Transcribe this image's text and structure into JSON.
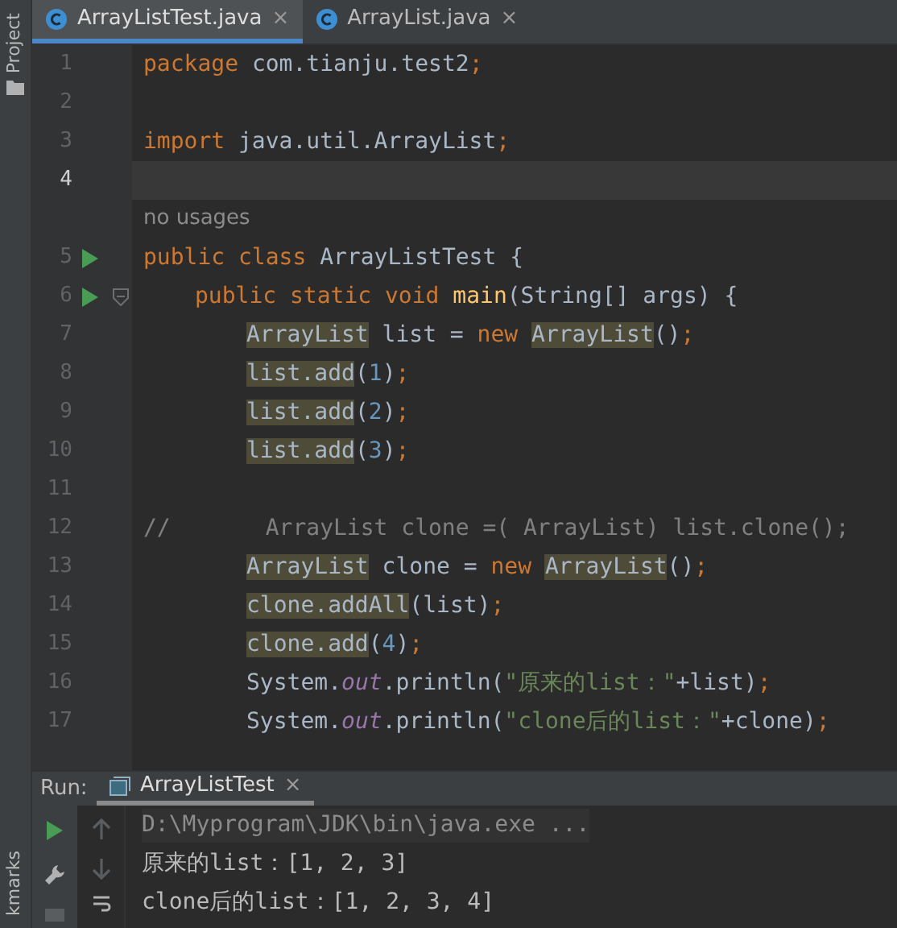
{
  "side_strip": {
    "top_label": "Project",
    "bottom_label": "kmarks"
  },
  "tabs": [
    {
      "label": "ArrayListTest.java",
      "selected": true,
      "close": "×"
    },
    {
      "label": "ArrayList.java",
      "selected": false,
      "close": "×"
    }
  ],
  "editor": {
    "lines": [
      {
        "kind": "top",
        "number": "1",
        "current": false,
        "run": false,
        "fold": false,
        "tokens": [
          {
            "t": "package",
            "kind": "kw"
          },
          {
            "t": " com.tianju.test2",
            "kind": "plain"
          },
          {
            "t": ";",
            "kind": "kw"
          }
        ]
      },
      {
        "kind": "top",
        "number": "2",
        "current": false,
        "run": false,
        "fold": false
      },
      {
        "kind": "top",
        "number": "3",
        "current": false,
        "run": false,
        "fold": false,
        "tokens": [
          {
            "t": "import",
            "kind": "kw"
          },
          {
            "t": " java.util.ArrayList",
            "kind": "plain"
          },
          {
            "t": ";",
            "kind": "kw"
          }
        ]
      },
      {
        "kind": "top",
        "number": "4",
        "current": true,
        "run": false,
        "fold": false
      },
      {
        "kind": "hint",
        "text": "no usages"
      },
      {
        "kind": "top",
        "number": "5",
        "current": false,
        "run": true,
        "fold": false,
        "tokens": [
          {
            "t": "public class",
            "kind": "kw"
          },
          {
            "t": " ArrayListTest {",
            "kind": "plain"
          }
        ]
      },
      {
        "kind": "member",
        "number": "6",
        "current": false,
        "run": true,
        "fold": true,
        "tokens": [
          {
            "t": "public static void ",
            "kind": "kw"
          },
          {
            "t": "main",
            "kind": "method"
          },
          {
            "t": "(String[] args) {",
            "kind": "plain"
          }
        ]
      },
      {
        "kind": "body",
        "number": "7",
        "current": false,
        "run": false,
        "fold": false,
        "tokens": [
          {
            "t": "ArrayList",
            "kind": "hl"
          },
          {
            "t": " list = ",
            "kind": "plain"
          },
          {
            "t": "new ",
            "kind": "kw"
          },
          {
            "t": "ArrayList",
            "kind": "hl"
          },
          {
            "t": "()",
            "kind": "plain"
          },
          {
            "t": ";",
            "kind": "kw"
          }
        ]
      },
      {
        "kind": "body",
        "number": "8",
        "current": false,
        "run": false,
        "fold": false,
        "tokens": [
          {
            "t": "list.add",
            "kind": "hl"
          },
          {
            "t": "(",
            "kind": "plain"
          },
          {
            "t": "1",
            "kind": "num"
          },
          {
            "t": ")",
            "kind": "plain"
          },
          {
            "t": ";",
            "kind": "kw"
          }
        ]
      },
      {
        "kind": "body",
        "number": "9",
        "current": false,
        "run": false,
        "fold": false,
        "tokens": [
          {
            "t": "list.add",
            "kind": "hl"
          },
          {
            "t": "(",
            "kind": "plain"
          },
          {
            "t": "2",
            "kind": "num"
          },
          {
            "t": ")",
            "kind": "plain"
          },
          {
            "t": ";",
            "kind": "kw"
          }
        ]
      },
      {
        "kind": "body",
        "number": "10",
        "current": false,
        "run": false,
        "fold": false,
        "tokens": [
          {
            "t": "list.add",
            "kind": "hl"
          },
          {
            "t": "(",
            "kind": "plain"
          },
          {
            "t": "3",
            "kind": "num"
          },
          {
            "t": ")",
            "kind": "plain"
          },
          {
            "t": ";",
            "kind": "kw"
          }
        ]
      },
      {
        "kind": "top",
        "number": "11",
        "current": false,
        "run": false,
        "fold": false
      },
      {
        "kind": "top",
        "number": "12",
        "current": false,
        "run": false,
        "fold": false,
        "tokens": [
          {
            "t": "//       ArrayList clone =( ArrayList) list.clone();",
            "kind": "comment"
          }
        ]
      },
      {
        "kind": "body",
        "number": "13",
        "current": false,
        "run": false,
        "fold": false,
        "tokens": [
          {
            "t": "ArrayList",
            "kind": "hl"
          },
          {
            "t": " clone = ",
            "kind": "plain"
          },
          {
            "t": "new ",
            "kind": "kw"
          },
          {
            "t": "ArrayList",
            "kind": "hl"
          },
          {
            "t": "()",
            "kind": "plain"
          },
          {
            "t": ";",
            "kind": "kw"
          }
        ]
      },
      {
        "kind": "body",
        "number": "14",
        "current": false,
        "run": false,
        "fold": false,
        "tokens": [
          {
            "t": "clone.addAll",
            "kind": "hl"
          },
          {
            "t": "(list)",
            "kind": "plain"
          },
          {
            "t": ";",
            "kind": "kw"
          }
        ]
      },
      {
        "kind": "body",
        "number": "15",
        "current": false,
        "run": false,
        "fold": false,
        "tokens": [
          {
            "t": "clone.add",
            "kind": "hl"
          },
          {
            "t": "(",
            "kind": "plain"
          },
          {
            "t": "4",
            "kind": "num"
          },
          {
            "t": ")",
            "kind": "plain"
          },
          {
            "t": ";",
            "kind": "kw"
          }
        ]
      },
      {
        "kind": "body",
        "number": "16",
        "current": false,
        "run": false,
        "fold": false,
        "tokens": [
          {
            "t": "System.",
            "kind": "plain"
          },
          {
            "t": "out",
            "kind": "field"
          },
          {
            "t": ".println(",
            "kind": "plain"
          },
          {
            "t": "\"原来的list：\"",
            "kind": "str"
          },
          {
            "t": "+list)",
            "kind": "plain"
          },
          {
            "t": ";",
            "kind": "kw"
          }
        ]
      },
      {
        "kind": "body",
        "number": "17",
        "current": false,
        "run": false,
        "fold": false,
        "tokens": [
          {
            "t": "System.",
            "kind": "plain"
          },
          {
            "t": "out",
            "kind": "field"
          },
          {
            "t": ".println(",
            "kind": "plain"
          },
          {
            "t": "\"clone后的list：\"",
            "kind": "str"
          },
          {
            "t": "+clone)",
            "kind": "plain"
          },
          {
            "t": ";",
            "kind": "kw"
          }
        ]
      }
    ]
  },
  "run_panel": {
    "label": "Run:",
    "tab": {
      "label": "ArrayListTest",
      "close": "×"
    },
    "console": [
      {
        "kind": "command",
        "text": "D:\\Myprogram\\JDK\\bin\\java.exe ..."
      },
      {
        "kind": "output",
        "text": "原来的list：[1, 2, 3]"
      },
      {
        "kind": "output",
        "text": "clone后的list：[1, 2, 3, 4]"
      }
    ]
  }
}
